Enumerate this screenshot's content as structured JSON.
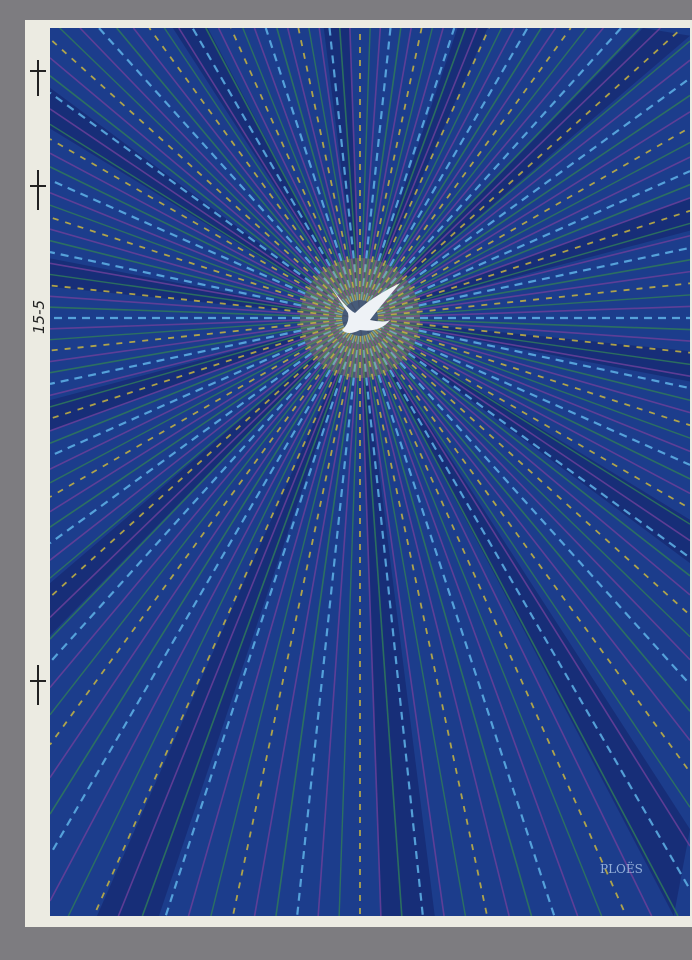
{
  "artwork": {
    "margin_note": "15-5",
    "signature": "PLOËS",
    "colors": {
      "background": "#1c3d8c",
      "dark_band": "#14246a",
      "light_blue": "#5fb3e8",
      "yellow": "#c9b640",
      "green": "#2f7a5a",
      "purple": "#6a3f9a",
      "dove": "#eef2f6"
    }
  }
}
